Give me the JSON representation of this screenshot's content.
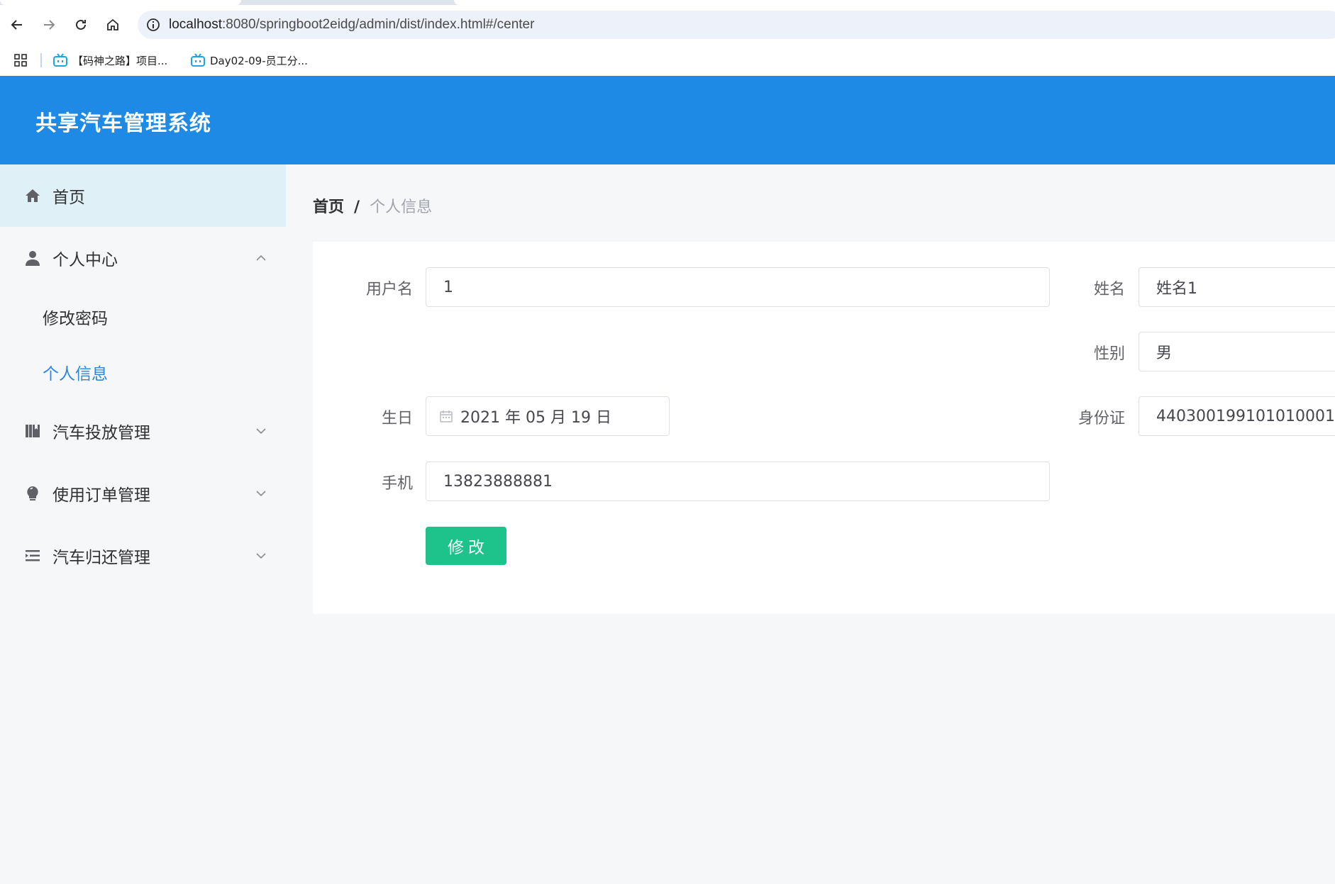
{
  "browser": {
    "url_host": "localhost",
    "url_path": ":8080/springboot2eidg/admin/dist/index.html#/center",
    "bookmarks": [
      {
        "label": "【码神之路】项目..."
      },
      {
        "label": "Day02-09-员工分..."
      }
    ]
  },
  "app": {
    "title": "共享汽车管理系统"
  },
  "sidebar": {
    "home": {
      "label": "首页",
      "icon": "home-icon"
    },
    "personal_center": {
      "label": "个人中心",
      "icon": "user-icon",
      "expanded": true,
      "children": [
        {
          "label": "修改密码"
        },
        {
          "label": "个人信息",
          "selected": true
        }
      ]
    },
    "car_delivery": {
      "label": "汽车投放管理",
      "icon": "book-icon"
    },
    "usage_orders": {
      "label": "使用订单管理",
      "icon": "bulb-icon"
    },
    "car_return": {
      "label": "汽车归还管理",
      "icon": "list-icon"
    }
  },
  "breadcrumb": {
    "home": "首页",
    "separator": "/",
    "current": "个人信息"
  },
  "form": {
    "username_label": "用户名",
    "username_value": "1",
    "name_label": "姓名",
    "name_value": "姓名1",
    "gender_label": "性别",
    "gender_value": "男",
    "birthday_label": "生日",
    "birthday_value": "2021 年 05 月 19 日",
    "idcard_label": "身份证",
    "idcard_value": "440300199101010001",
    "phone_label": "手机",
    "phone_value": "13823888881",
    "submit_label": "修改"
  },
  "colors": {
    "header": "#1e8ae6",
    "accent": "#2a88e0",
    "submit": "#1ec28b",
    "active_menu_bg": "#dff1f7"
  }
}
